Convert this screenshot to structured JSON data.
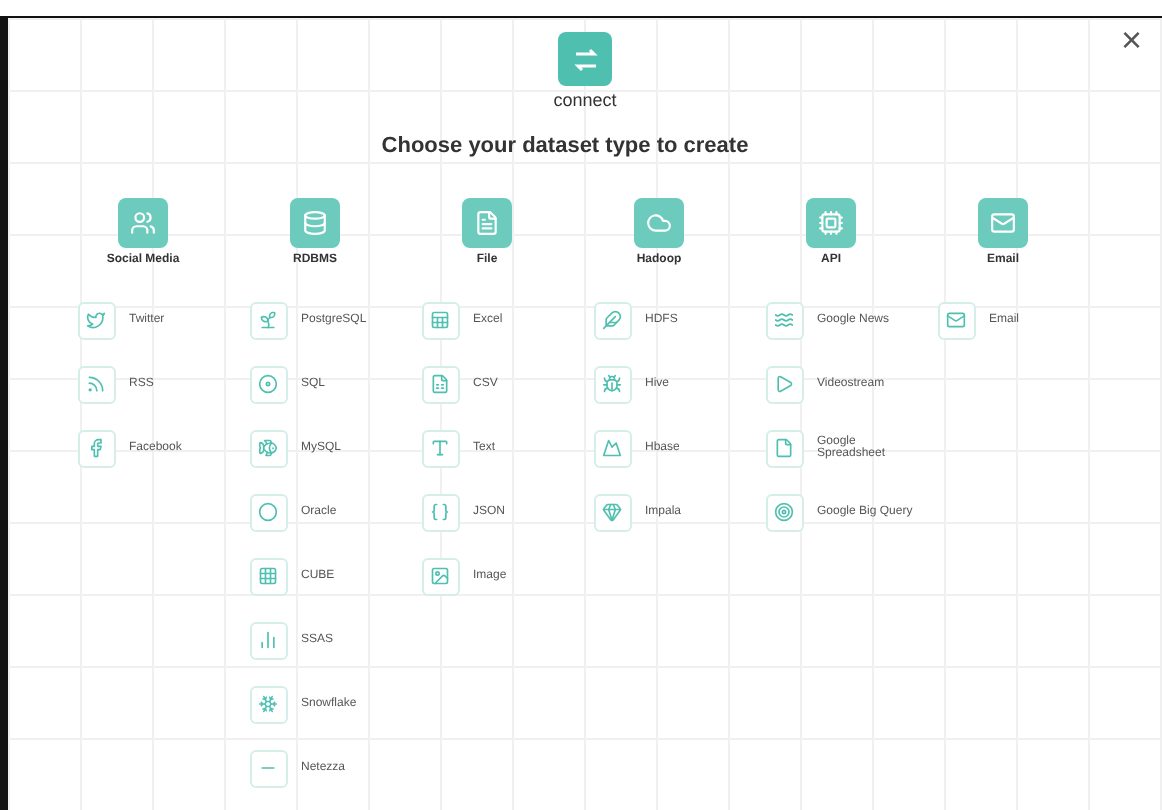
{
  "header": {
    "logo_label": "connect",
    "title": "Choose your dataset type to create"
  },
  "close": {
    "symbol": "×"
  },
  "categories": [
    {
      "label": "Social Media",
      "items": [
        {
          "label": "Twitter"
        },
        {
          "label": "RSS"
        },
        {
          "label": "Facebook"
        }
      ]
    },
    {
      "label": "RDBMS",
      "items": [
        {
          "label": "PostgreSQL"
        },
        {
          "label": "SQL"
        },
        {
          "label": "MySQL"
        },
        {
          "label": "Oracle"
        },
        {
          "label": "CUBE"
        },
        {
          "label": "SSAS"
        },
        {
          "label": "Snowflake"
        },
        {
          "label": "Netezza"
        }
      ]
    },
    {
      "label": "File",
      "items": [
        {
          "label": "Excel"
        },
        {
          "label": "CSV"
        },
        {
          "label": "Text"
        },
        {
          "label": "JSON"
        },
        {
          "label": "Image"
        }
      ]
    },
    {
      "label": "Hadoop",
      "items": [
        {
          "label": "HDFS"
        },
        {
          "label": "Hive"
        },
        {
          "label": "Hbase"
        },
        {
          "label": "Impala"
        }
      ]
    },
    {
      "label": "API",
      "items": [
        {
          "label": "Google News"
        },
        {
          "label": "Videostream"
        },
        {
          "label": "Google Spreadsheet"
        },
        {
          "label": "Google Big Query"
        }
      ]
    },
    {
      "label": "Email",
      "items": [
        {
          "label": "Email"
        }
      ]
    }
  ]
}
